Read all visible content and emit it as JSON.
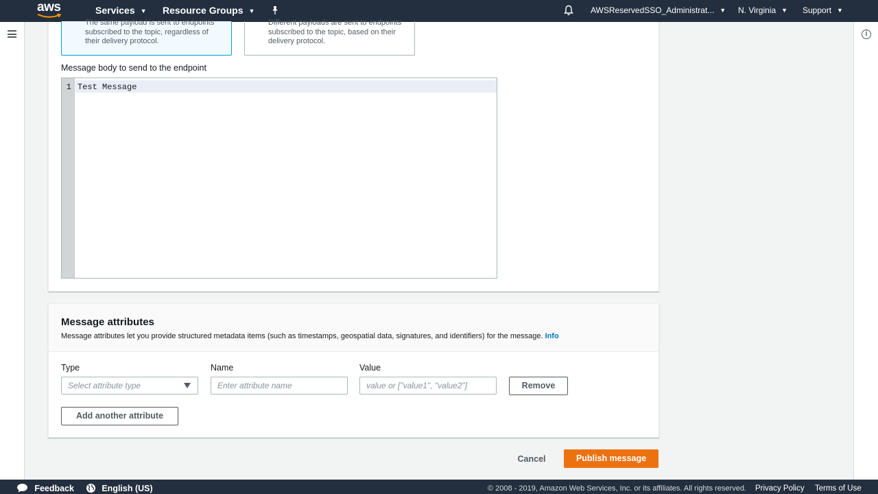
{
  "nav": {
    "logo": "aws",
    "services": "Services",
    "resource_groups": "Resource Groups",
    "pin_icon": "pin-icon",
    "account": "AWSReservedSSO_Administrat...",
    "region": "N. Virginia",
    "support": "Support"
  },
  "message_structure": {
    "identical_desc": "The same payload is sent to endpoints subscribed to the topic, regardless of their delivery protocol.",
    "custom_desc": "Different payloads are sent to endpoints subscribed to the topic, based on their delivery protocol."
  },
  "message_body": {
    "label": "Message body to send to the endpoint",
    "line_number": "1",
    "content": "Test Message"
  },
  "attributes": {
    "title": "Message attributes",
    "description": "Message attributes let you provide structured metadata items (such as timestamps, geospatial data, signatures, and identifiers) for the message.",
    "info_link": "Info",
    "type_label": "Type",
    "name_label": "Name",
    "value_label": "Value",
    "type_placeholder": "Select attribute type",
    "name_placeholder": "Enter attribute name",
    "value_placeholder": "value or [\"value1\", \"value2\"]",
    "remove_button": "Remove",
    "add_button": "Add another attribute"
  },
  "actions": {
    "cancel": "Cancel",
    "publish": "Publish message"
  },
  "footer": {
    "feedback": "Feedback",
    "language": "English (US)",
    "copyright": "© 2008 - 2019, Amazon Web Services, Inc. or its affiliates. All rights reserved.",
    "privacy": "Privacy Policy",
    "terms": "Terms of Use"
  },
  "colors": {
    "nav_bg": "#232f3e",
    "primary_button": "#ec7211",
    "link": "#0073bb",
    "selected_tile_border": "#00a1c9"
  }
}
